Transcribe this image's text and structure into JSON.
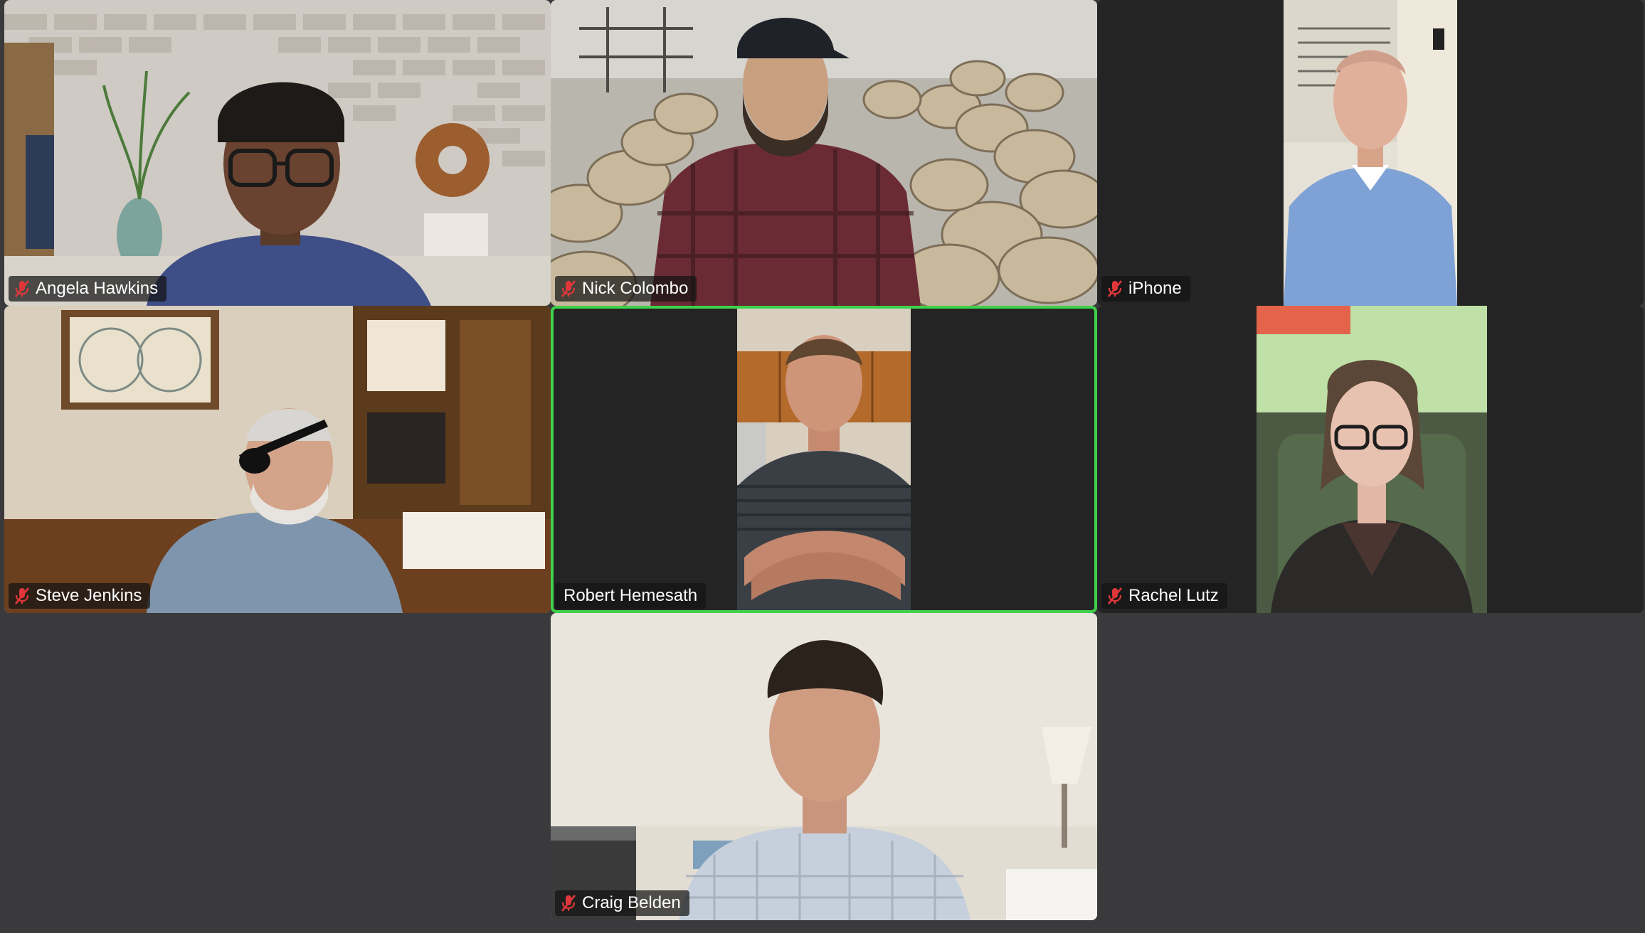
{
  "meeting": {
    "participants": [
      {
        "id": "angela",
        "name": "Angela Hawkins",
        "muted": true,
        "speaking": false
      },
      {
        "id": "nick",
        "name": "Nick Colombo",
        "muted": true,
        "speaking": false
      },
      {
        "id": "iphone",
        "name": "iPhone",
        "muted": true,
        "speaking": false
      },
      {
        "id": "steve",
        "name": "Steve Jenkins",
        "muted": true,
        "speaking": false
      },
      {
        "id": "robert",
        "name": "Robert Hemesath",
        "muted": false,
        "speaking": true
      },
      {
        "id": "rachel",
        "name": "Rachel Lutz",
        "muted": true,
        "speaking": false
      },
      {
        "id": "craig",
        "name": "Craig Belden",
        "muted": true,
        "speaking": false
      }
    ]
  },
  "colors": {
    "background": "#3a3a3c",
    "tile": "#242424",
    "active_speaker_border": "#3fd14b",
    "muted_icon": "#e0373a"
  },
  "icons": {
    "muted": "mic-muted-icon"
  }
}
